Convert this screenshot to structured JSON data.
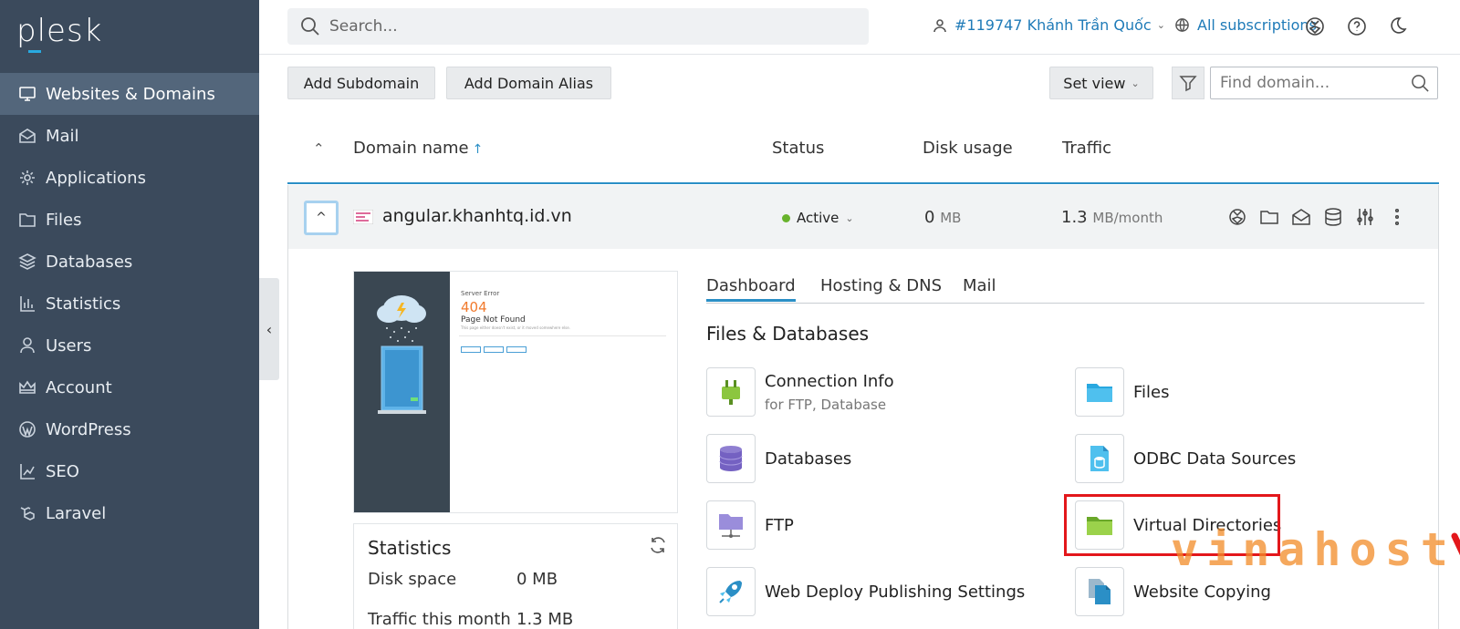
{
  "app": {
    "logo": "plesk"
  },
  "sidebar": {
    "items": [
      {
        "label": "Websites & Domains",
        "icon": "monitor-icon",
        "active": true
      },
      {
        "label": "Mail",
        "icon": "mail-icon"
      },
      {
        "label": "Applications",
        "icon": "gear-icon"
      },
      {
        "label": "Files",
        "icon": "folder-icon"
      },
      {
        "label": "Databases",
        "icon": "layers-icon"
      },
      {
        "label": "Statistics",
        "icon": "bar-chart-icon"
      },
      {
        "label": "Users",
        "icon": "user-icon"
      },
      {
        "label": "Account",
        "icon": "crown-icon"
      },
      {
        "label": "WordPress",
        "icon": "wordpress-icon"
      },
      {
        "label": "SEO",
        "icon": "seo-icon"
      },
      {
        "label": "Laravel",
        "icon": "laravel-icon"
      }
    ],
    "collapse_glyph": "‹"
  },
  "topbar": {
    "search_placeholder": "Search...",
    "user_label": "#119747 Khánh Trần Quốc",
    "subscriptions_label": "All subscriptions",
    "chevron": "⌄"
  },
  "toolbar": {
    "add_subdomain": "Add Subdomain",
    "add_domain_alias": "Add Domain Alias",
    "set_view": "Set view",
    "find_placeholder": "Find domain..."
  },
  "table": {
    "sort_glyph": "⌃",
    "col_domain": "Domain name",
    "sort_arrow": "↑",
    "col_status": "Status",
    "col_disk": "Disk usage",
    "col_traffic": "Traffic"
  },
  "domain_row": {
    "name": "angular.khanhtq.id.vn",
    "status": "Active",
    "disk_value": "0",
    "disk_unit": "MB",
    "traffic_value": "1.3",
    "traffic_unit": "MB/month",
    "expand_glyph": "^"
  },
  "preview": {
    "small_title": "Server Error",
    "code": "404",
    "heading": "Page Not Found",
    "note": "This page either doesn't exist, or it moved somewhere else."
  },
  "statistics": {
    "title": "Statistics",
    "rows": [
      {
        "label": "Disk space",
        "value": "0 MB"
      },
      {
        "label": "Traffic this month",
        "value": "1.3 MB"
      }
    ]
  },
  "tabs": [
    "Dashboard",
    "Hosting & DNS",
    "Mail"
  ],
  "section_title": "Files & Databases",
  "tools": [
    {
      "name": "Connection Info",
      "sub": "for FTP, Database",
      "icon": "plug-icon"
    },
    {
      "name": "Files",
      "sub": "",
      "icon": "blue-folder-icon"
    },
    {
      "name": "Databases",
      "sub": "",
      "icon": "database-icon"
    },
    {
      "name": "ODBC Data Sources",
      "sub": "",
      "icon": "odbc-icon"
    },
    {
      "name": "FTP",
      "sub": "",
      "icon": "ftp-icon"
    },
    {
      "name": "Virtual Directories",
      "sub": "",
      "icon": "green-folder-icon"
    },
    {
      "name": "Web Deploy Publishing Settings",
      "sub": "",
      "icon": "rocket-icon"
    },
    {
      "name": "Website Copying",
      "sub": "",
      "icon": "copy-icon"
    }
  ],
  "watermark": "vinahost",
  "colors": {
    "sidebar_bg": "#3b4a5c",
    "sidebar_active": "#53667b",
    "accent": "#2b8fc6",
    "link": "#1f7bb8",
    "status_active": "#68b32c",
    "highlight": "#e3171b",
    "watermark": "#f28c28"
  }
}
